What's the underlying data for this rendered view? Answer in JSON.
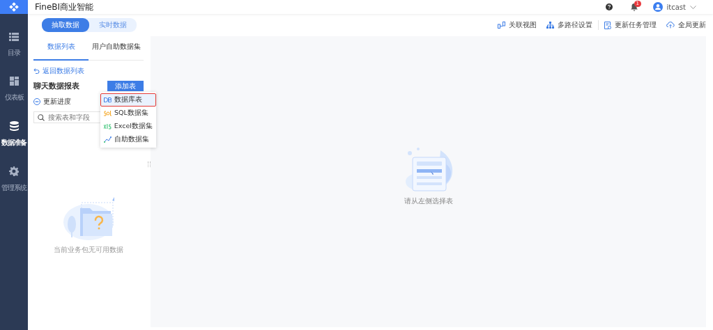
{
  "app_title": "FineBI商业智能",
  "header": {
    "notification_count": "1",
    "username": "itcast"
  },
  "nav": [
    {
      "label": "目录",
      "kind": "list",
      "selected": false
    },
    {
      "label": "仪表板",
      "kind": "dashboard",
      "selected": false
    },
    {
      "label": "数据准备",
      "kind": "database",
      "selected": true
    },
    {
      "label": "管理系统",
      "kind": "gear",
      "selected": false
    }
  ],
  "mode_tabs": [
    {
      "label": "抽取数据",
      "selected": true
    },
    {
      "label": "实时数据",
      "selected": false
    }
  ],
  "toolbar": [
    {
      "label": "关联视图",
      "kind": "relation"
    },
    {
      "label": "多路径设置",
      "kind": "tree"
    },
    {
      "label": "更新任务管理",
      "kind": "task"
    },
    {
      "label": "全局更新",
      "kind": "cloud"
    }
  ],
  "panel_tabs": [
    {
      "label": "数据列表",
      "selected": true
    },
    {
      "label": "用户自助数据集",
      "selected": false
    }
  ],
  "back_link": "返回数据列表",
  "package_title": "聊天数据报表",
  "add_button": "添加表",
  "update_progress": "更新进度",
  "search": {
    "placeholder": "搜索表和字段"
  },
  "add_menu": [
    {
      "label": "数据库表",
      "kind": "db",
      "selected": true
    },
    {
      "label": "SQL数据集",
      "kind": "sql",
      "selected": false
    },
    {
      "label": "Excel数据集",
      "kind": "excel",
      "selected": false
    },
    {
      "label": "自助数据集",
      "kind": "self",
      "selected": false
    }
  ],
  "empty_package_text": "当前业务包无可用数据",
  "main_hint": "请从左侧选择表"
}
